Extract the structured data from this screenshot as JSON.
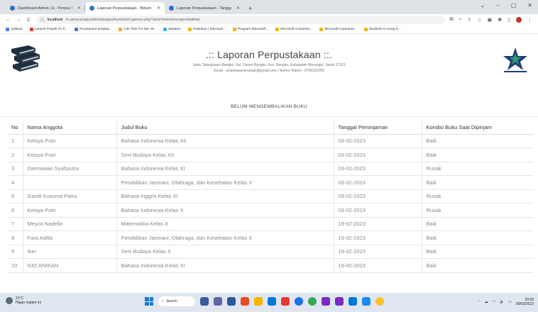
{
  "browser": {
    "tabs": [
      {
        "title": "Dashboard Admin | E - Perpus SI",
        "color": "#2f6fd6"
      },
      {
        "title": "Laporan Perpustakaan - Belum M",
        "color": "#2f6fd6"
      },
      {
        "title": "Laporan Perpustakaan - Tanggal",
        "color": "#2f6fd6"
      }
    ],
    "new_tab": "+",
    "window_controls": [
      "⌄",
      "–",
      "▢",
      "✕"
    ],
    "url_host": "localhost",
    "url_rest": "/e-perpus/app/admin/pages/function/Laporan.php?aksi=belummengembalikan",
    "bookmarks": [
      {
        "label": "Aplikasi",
        "color": "#4285f4"
      },
      {
        "label": "Laravel Proyek #1 P...",
        "color": "#e53935"
      },
      {
        "label": "Powerpoint templat...",
        "color": "#5c6bc0"
      },
      {
        "label": "Cite This For Me: W...",
        "color": "#f9a825"
      },
      {
        "label": "Bstation",
        "color": "#29b6f6"
      },
      {
        "label": "Pelatihan | Microsof...",
        "color": "#f4b400"
      },
      {
        "label": "Program Microsoft...",
        "color": "#f4b400"
      },
      {
        "label": "Microsoft Customer...",
        "color": "#f4b400"
      },
      {
        "label": "Microsoft Customer...",
        "color": "#f4b400"
      },
      {
        "label": "Students in Hong K...",
        "color": "#f4b400"
      }
    ]
  },
  "report": {
    "title": ".:: Laporan Perpustakaan ::.",
    "address": "Jalan Talangkawo Bangko, Kel. Dusun Bangko, Kec. Bangko, Kabupaten Merangin, Jambi 37313",
    "contact": "Email : smankasamerangin@gmail.com | Nomor Telpon : 0746322359",
    "subtitle": "BELUM MENGEMBALIKAN BUKU"
  },
  "table": {
    "headers": [
      "No",
      "Nama Anggota",
      "Judul Buku",
      "Tanggal Peminjaman",
      "Kondisi Buku Saat Dipinjam"
    ],
    "rows": [
      [
        "1",
        "Keisya Putri",
        "Bahasa Indonesia Kelas XII",
        "03-02-2023",
        "Baik"
      ],
      [
        "2",
        "Keisya Putri",
        "Seni Budaya Kelas XII",
        "03-02-2023",
        "Baik"
      ],
      [
        "3",
        "Darmawan Syahputra",
        "Bahasa Indonesia Kelas XI",
        "03-02-2023",
        "Rusak"
      ],
      [
        "4",
        "",
        "Pendidikan Jasmani, Olahraga, dan Kesehatan Kelas X",
        "03-02-2023",
        "Baik"
      ],
      [
        "5",
        "Gandi Kusuma Patra",
        "Bahasa Inggris Kelas XI",
        "03-02-2023",
        "Rusak"
      ],
      [
        "6",
        "Keisya Putri",
        "Bahasa Indonesia Kelas X",
        "03-02-2023",
        "Rusak"
      ],
      [
        "7",
        "Meyza Nadella",
        "Matematika Kelas X",
        "19-02-2023",
        "Baik"
      ],
      [
        "8",
        "Fara Adilla",
        "Pendidikan Jasmani, Olahraga, dan Kesehatan Kelas X",
        "19-02-2023",
        "Baik"
      ],
      [
        "9",
        "Iker",
        "Seni Budaya Kelas X",
        "19-02-2023",
        "Baik"
      ],
      [
        "10",
        "GIO ANRIAN",
        "Bahasa Indonesia Kelas XI",
        "19-02-2023",
        "Baik"
      ]
    ]
  },
  "taskbar": {
    "weather_temp": "21°C",
    "weather_desc": "Hujan malam ini",
    "search_label": "Search",
    "time": "20:00",
    "date": "09/03/2023"
  }
}
